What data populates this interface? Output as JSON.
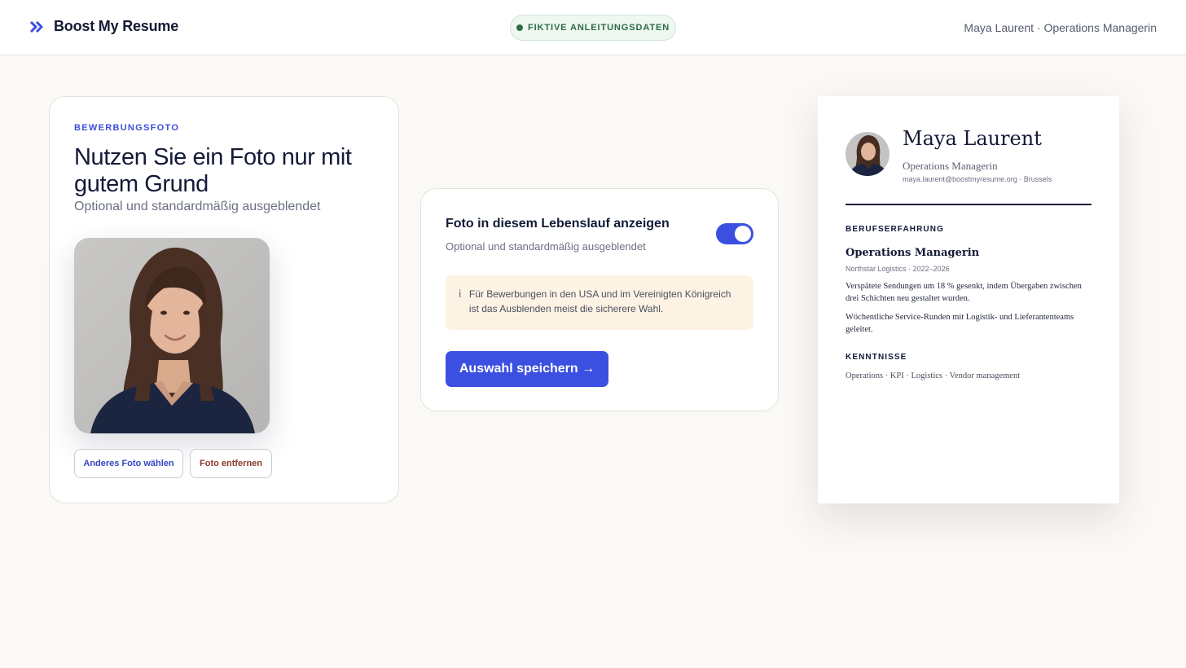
{
  "header": {
    "brand_name": "Boost My Resume",
    "badge_label": "FIKTIVE ANLEITUNGSDATEN",
    "user_info": "Maya Laurent · Operations Managerin"
  },
  "photo_card": {
    "eyebrow": "BEWERBUNGSFOTO",
    "headline": "Nutzen Sie ein Foto nur mit gutem Grund",
    "subline": "Optional und standardmäßig ausgeblendet",
    "choose_button": "Anderes Foto wählen",
    "remove_button": "Foto entfernen"
  },
  "toggle_card": {
    "title": "Foto in diesem Lebenslauf anzeigen",
    "subtitle": "Optional und standardmäßig ausgeblendet",
    "toggle_on": true,
    "info_icon": "i",
    "notice": "Für Bewerbungen in den USA und im Vereinigten Königreich ist das Ausblenden meist die sicherere Wahl.",
    "save_button": "Auswahl speichern →"
  },
  "resume": {
    "name": "Maya Laurent",
    "role": "Operations Managerin",
    "contact": "maya.laurent@boostmyresume.org · Brussels",
    "experience_heading": "BERUFSERFAHRUNG",
    "job_title": "Operations Managerin",
    "company": "Northstar Logistics · 2022–2026",
    "bullets": [
      "Verspätete Sendungen um 18 % gesenkt, indem Übergaben zwischen drei Schichten neu gestaltet wurden.",
      "Wöchentliche Service-Runden mit Logistik- und Lieferantenteams geleitet."
    ],
    "skills_heading": "KENNTNISSE",
    "skills": "Operations · KPI · Logistics · Vendor management"
  },
  "colors": {
    "accent": "#3b4fe0",
    "badge_green": "#2c6b45",
    "notice_bg": "#fdf3e4",
    "remove_red": "#8a3a2a"
  }
}
